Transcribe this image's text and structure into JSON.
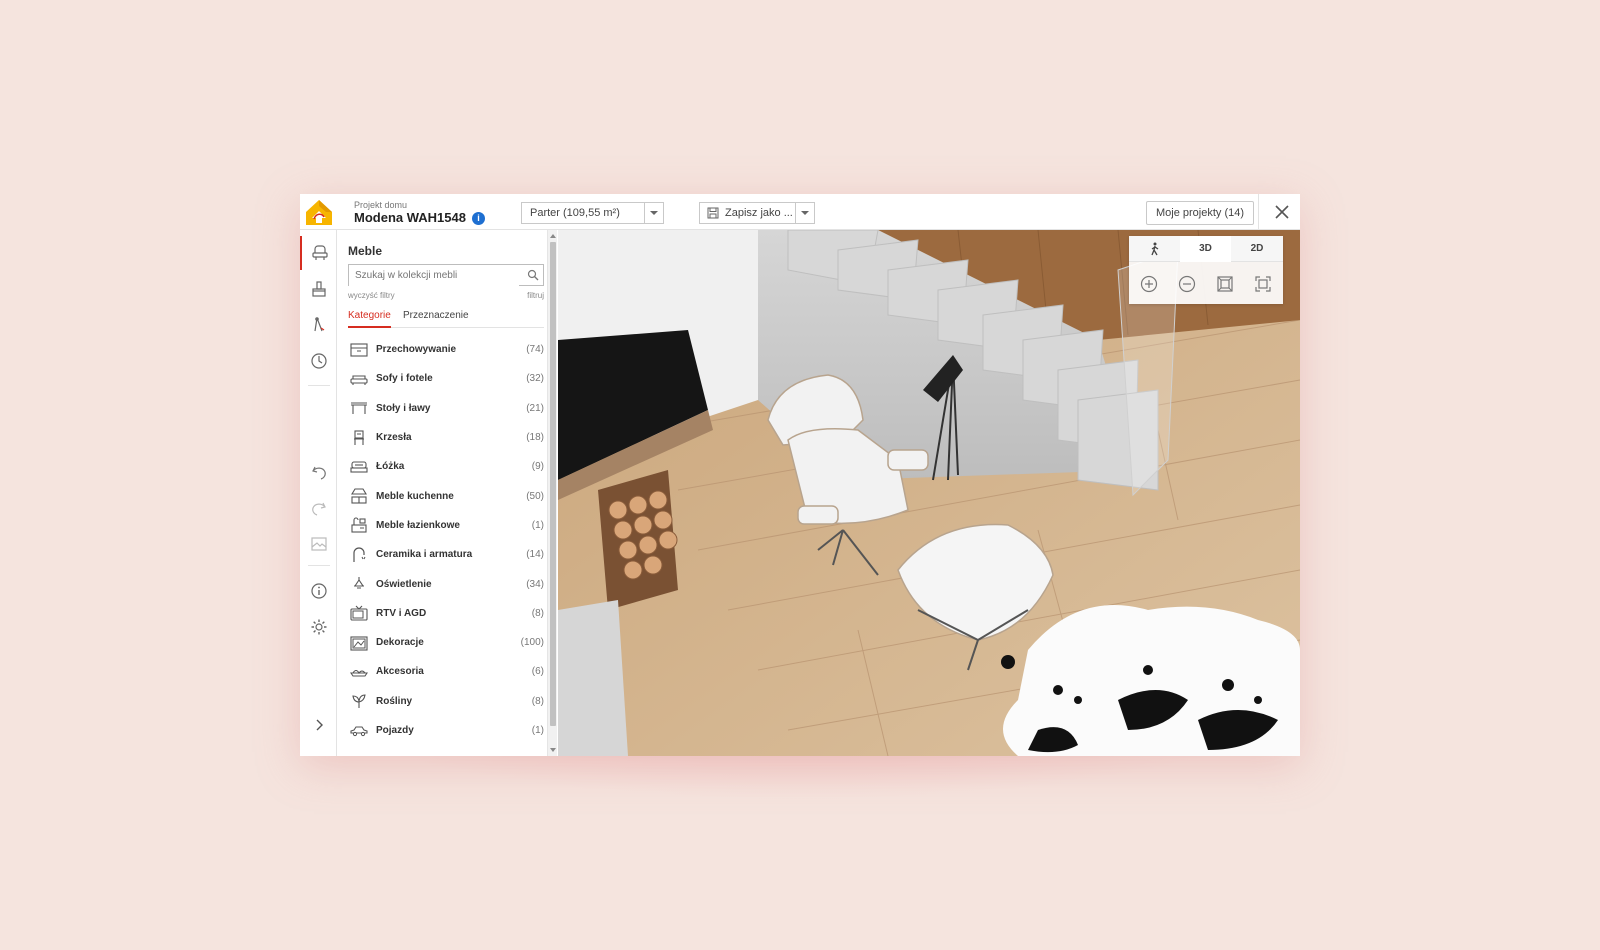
{
  "header": {
    "project_label": "Projekt domu",
    "project_name": "Modena WAH1548",
    "info_icon": "i",
    "floor_select": "Parter (109,55 m²)",
    "save_select": "Zapisz jako ...",
    "my_projects": "Moje projekty (14)"
  },
  "panel": {
    "title": "Meble",
    "search_placeholder": "Szukaj w kolekcji mebli",
    "clear_filters": "wyczyść filtry",
    "filter": "filtruj",
    "tabs": [
      "Kategorie",
      "Przeznaczenie"
    ],
    "categories": [
      {
        "name": "Przechowywanie",
        "count": "(74)",
        "icon": "storage-icon"
      },
      {
        "name": "Sofy i fotele",
        "count": "(32)",
        "icon": "sofa-icon"
      },
      {
        "name": "Stoły i ławy",
        "count": "(21)",
        "icon": "table-icon"
      },
      {
        "name": "Krzesła",
        "count": "(18)",
        "icon": "chair-icon"
      },
      {
        "name": "Łóżka",
        "count": "(9)",
        "icon": "bed-icon"
      },
      {
        "name": "Meble kuchenne",
        "count": "(50)",
        "icon": "kitchen-icon"
      },
      {
        "name": "Meble łazienkowe",
        "count": "(1)",
        "icon": "bathroom-icon"
      },
      {
        "name": "Ceramika i armatura",
        "count": "(14)",
        "icon": "faucet-icon"
      },
      {
        "name": "Oświetlenie",
        "count": "(34)",
        "icon": "lamp-icon"
      },
      {
        "name": "RTV i AGD",
        "count": "(8)",
        "icon": "tv-icon"
      },
      {
        "name": "Dekoracje",
        "count": "(100)",
        "icon": "picture-icon"
      },
      {
        "name": "Akcesoria",
        "count": "(6)",
        "icon": "accessory-icon"
      },
      {
        "name": "Rośliny",
        "count": "(8)",
        "icon": "plant-icon"
      },
      {
        "name": "Pojazdy",
        "count": "(1)",
        "icon": "car-icon"
      }
    ]
  },
  "view_controls": {
    "tabs": [
      "3D",
      "2D"
    ],
    "active_tab": "3D"
  },
  "colors": {
    "accent": "#d62d20",
    "logo_yellow": "#f7b500",
    "info_blue": "#1e6fd1",
    "background": "#f5e4de"
  }
}
